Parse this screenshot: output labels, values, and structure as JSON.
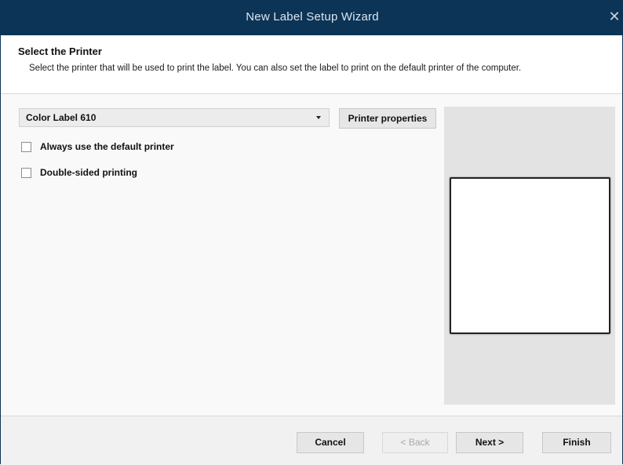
{
  "window": {
    "title": "New Label Setup Wizard",
    "close_glyph": "✕"
  },
  "header": {
    "title": "Select the Printer",
    "description": "Select the printer that will be used to print the label. You can also set the label to print on the default printer of the computer."
  },
  "printer": {
    "selected": "Color Label 610",
    "properties_label": "Printer properties"
  },
  "options": {
    "always_default": {
      "label": "Always use the default printer",
      "checked": false
    },
    "double_sided": {
      "label": "Double-sided printing",
      "checked": false
    }
  },
  "footer": {
    "cancel_label": "Cancel",
    "back_label": "< Back",
    "next_label": "Next >",
    "finish_label": "Finish"
  },
  "colors": {
    "titlebar": "#0b3457",
    "preview_bg": "#e3e3e3",
    "disabled_text": "#a8a8a8"
  },
  "icons": {
    "close": "close-icon",
    "dropdown": "chevron-down-icon"
  }
}
